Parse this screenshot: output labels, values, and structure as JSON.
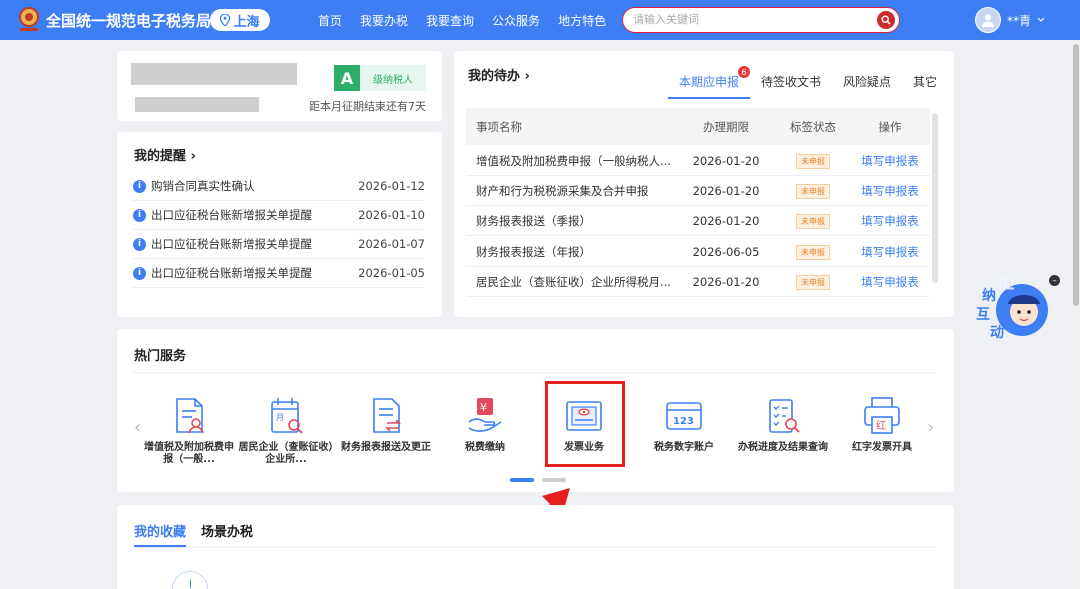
{
  "header": {
    "site_title": "全国统一规范电子税务局",
    "city": "上海",
    "nav": [
      "首页",
      "我要办税",
      "我要查询",
      "公众服务",
      "地方特色"
    ],
    "search_placeholder": "请输入关键词",
    "user_name": "**青"
  },
  "taxpayer": {
    "grade": "A",
    "grade_label": "级纳税人",
    "deadline_text": "距本月征期结束还有7天"
  },
  "reminders": {
    "title": "我的提醒",
    "items": [
      {
        "text": "购销合同真实性确认",
        "date": "2026-01-12"
      },
      {
        "text": "出口应征税台账新增报关单提醒",
        "date": "2026-01-10"
      },
      {
        "text": "出口应征税台账新增报关单提醒",
        "date": "2026-01-07"
      },
      {
        "text": "出口应征税台账新增报关单提醒",
        "date": "2026-01-05"
      }
    ]
  },
  "todo": {
    "title": "我的待办",
    "tabs": [
      {
        "label": "本期应申报",
        "badge": "6",
        "active": true
      },
      {
        "label": "待签收文书"
      },
      {
        "label": "风险疑点"
      },
      {
        "label": "其它"
      }
    ],
    "columns": [
      "事项名称",
      "办理期限",
      "标签状态",
      "操作"
    ],
    "rows": [
      {
        "name": "增值税及附加税费申报（一般纳税人...",
        "deadline": "2026-01-20",
        "status": "未申报",
        "action": "填写申报表"
      },
      {
        "name": "财产和行为税税源采集及合并申报",
        "deadline": "2026-01-20",
        "status": "未申报",
        "action": "填写申报表"
      },
      {
        "name": "财务报表报送（季报）",
        "deadline": "2026-01-20",
        "status": "未申报",
        "action": "填写申报表"
      },
      {
        "name": "财务报表报送（年报）",
        "deadline": "2026-06-05",
        "status": "未申报",
        "action": "填写申报表"
      },
      {
        "name": "居民企业（查账征收）企业所得税月...",
        "deadline": "2026-01-20",
        "status": "未申报",
        "action": "填写申报表"
      }
    ]
  },
  "hot_services": {
    "title": "热门服务",
    "items": [
      {
        "label": "增值税及附加税费申报（一般...",
        "icon": "tax-declare-icon"
      },
      {
        "label": "居民企业（查账征收）企业所...",
        "icon": "calendar-search-icon"
      },
      {
        "label": "财务报表报送及更正",
        "icon": "report-exchange-icon"
      },
      {
        "label": "税费缴纳",
        "icon": "payment-hand-icon"
      },
      {
        "label": "发票业务",
        "icon": "invoice-icon"
      },
      {
        "label": "税务数字账户",
        "icon": "digital-account-icon"
      },
      {
        "label": "办税进度及结果查询",
        "icon": "progress-query-icon"
      },
      {
        "label": "红字发票开具",
        "icon": "red-invoice-printer-icon"
      }
    ]
  },
  "favorites": {
    "tabs": [
      "我的收藏",
      "场景办税"
    ]
  },
  "mascot": {
    "chars": [
      "征",
      "纳",
      "互",
      "动"
    ]
  },
  "colors": {
    "primary": "#3d7ef5",
    "highlight": "#e62020",
    "grade_green": "#2cb067",
    "status_orange": "#e8832a"
  }
}
